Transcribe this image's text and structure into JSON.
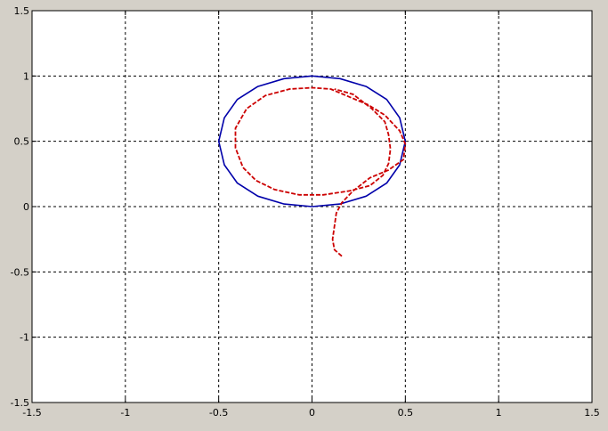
{
  "figure": {
    "background": "#d4d0c8",
    "axes_background": "#ffffff"
  },
  "chart_data": {
    "type": "line",
    "title": "",
    "xlabel": "",
    "ylabel": "",
    "xlim": [
      -1.5,
      1.5
    ],
    "ylim": [
      -1.5,
      1.5
    ],
    "xticks": [
      -1.5,
      -1,
      -0.5,
      0,
      0.5,
      1,
      1.5
    ],
    "yticks": [
      -1.5,
      -1,
      -0.5,
      0,
      0.5,
      1,
      1.5
    ],
    "xtick_labels": [
      "-1.5",
      "-1",
      "-0.5",
      "0",
      "0.5",
      "1",
      "1.5"
    ],
    "ytick_labels": [
      "-1.5",
      "-1",
      "-0.5",
      "0",
      "0.5",
      "1",
      "1.5"
    ],
    "grid": true,
    "grid_style": "dashed",
    "series": [
      {
        "style": "solid",
        "color": "#0000aa",
        "closed": true,
        "points": [
          [
            0.0,
            1.0
          ],
          [
            0.15,
            0.98
          ],
          [
            0.29,
            0.92
          ],
          [
            0.4,
            0.82
          ],
          [
            0.47,
            0.68
          ],
          [
            0.5,
            0.5
          ],
          [
            0.47,
            0.32
          ],
          [
            0.4,
            0.18
          ],
          [
            0.29,
            0.08
          ],
          [
            0.15,
            0.02
          ],
          [
            0.0,
            0.0
          ],
          [
            -0.15,
            0.02
          ],
          [
            -0.29,
            0.08
          ],
          [
            -0.4,
            0.18
          ],
          [
            -0.47,
            0.32
          ],
          [
            -0.5,
            0.5
          ],
          [
            -0.47,
            0.68
          ],
          [
            -0.4,
            0.82
          ],
          [
            -0.29,
            0.92
          ],
          [
            -0.15,
            0.98
          ]
        ]
      },
      {
        "style": "dashed",
        "color": "#cc0000",
        "closed": false,
        "points": [
          [
            0.16,
            -0.38
          ],
          [
            0.12,
            -0.33
          ],
          [
            0.11,
            -0.25
          ],
          [
            0.12,
            -0.15
          ],
          [
            0.13,
            -0.05
          ],
          [
            0.16,
            0.03
          ],
          [
            0.22,
            0.12
          ],
          [
            0.31,
            0.22
          ],
          [
            0.41,
            0.28
          ],
          [
            0.49,
            0.36
          ],
          [
            0.5,
            0.48
          ],
          [
            0.47,
            0.58
          ],
          [
            0.39,
            0.7
          ],
          [
            0.3,
            0.78
          ],
          [
            0.2,
            0.84
          ],
          [
            0.1,
            0.9
          ],
          [
            0.0,
            0.91
          ],
          [
            -0.12,
            0.9
          ],
          [
            -0.25,
            0.85
          ],
          [
            -0.35,
            0.75
          ],
          [
            -0.41,
            0.6
          ],
          [
            -0.41,
            0.45
          ],
          [
            -0.37,
            0.3
          ],
          [
            -0.3,
            0.2
          ],
          [
            -0.2,
            0.13
          ],
          [
            -0.07,
            0.09
          ],
          [
            0.06,
            0.09
          ],
          [
            0.2,
            0.12
          ],
          [
            0.31,
            0.16
          ],
          [
            0.38,
            0.24
          ],
          [
            0.41,
            0.33
          ],
          [
            0.42,
            0.44
          ],
          [
            0.41,
            0.55
          ],
          [
            0.39,
            0.65
          ],
          [
            0.32,
            0.75
          ],
          [
            0.22,
            0.86
          ],
          [
            0.12,
            0.9
          ]
        ]
      }
    ]
  }
}
